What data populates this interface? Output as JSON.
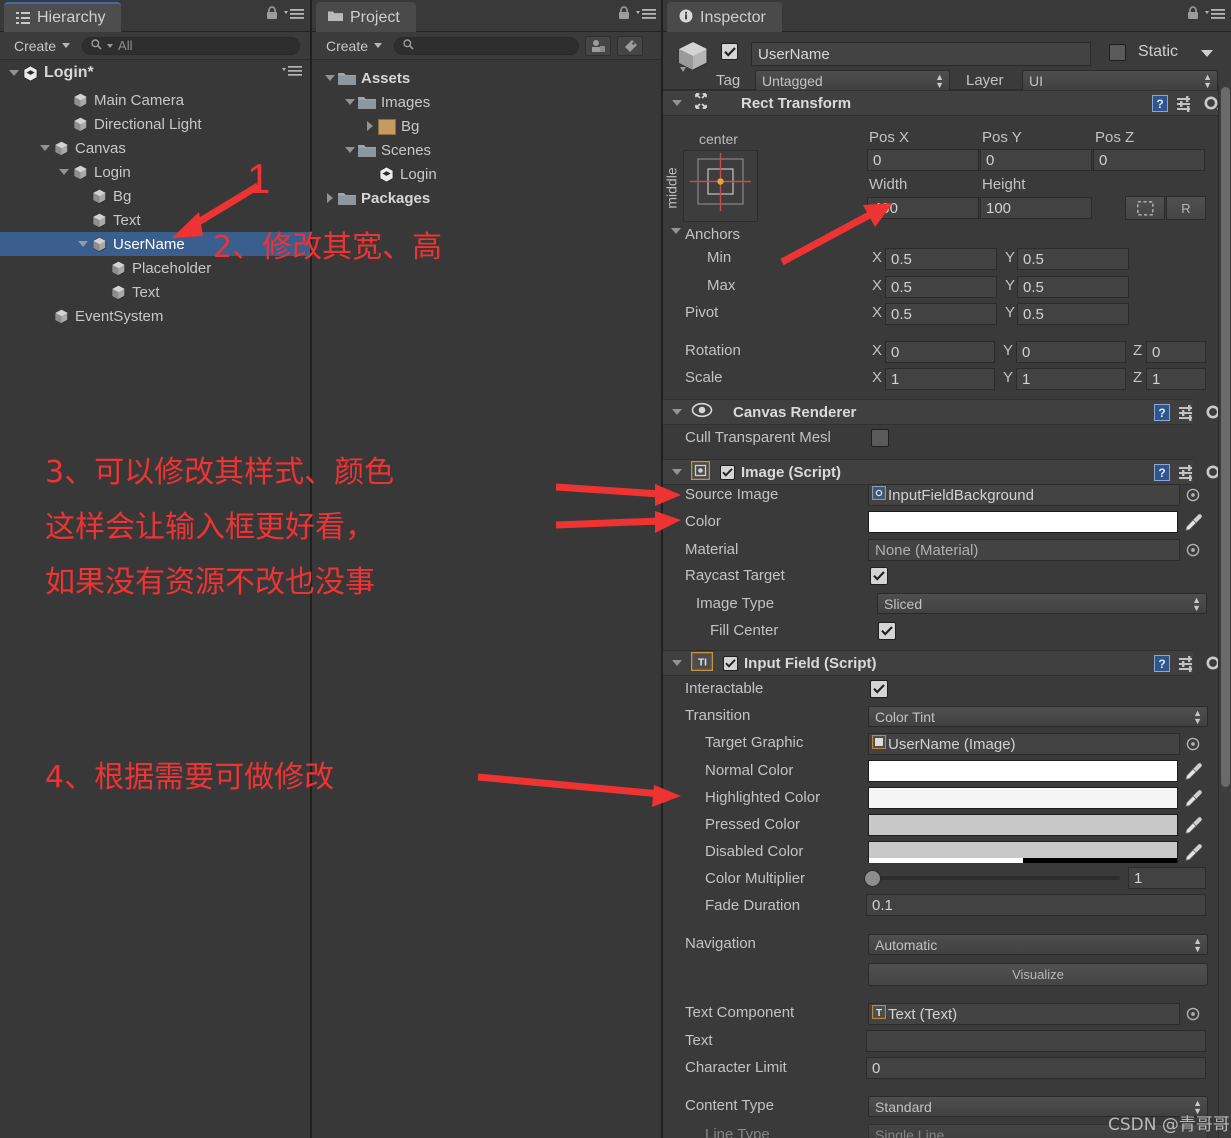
{
  "hierarchy": {
    "tab_label": "Hierarchy",
    "tab_icon": "hierarchy-icon",
    "create_label": "Create",
    "search_placeholder": "All",
    "scene_name": "Login*",
    "items": [
      {
        "label": "Main Camera",
        "depth": 2,
        "icon": "gameobject-cube-icon",
        "expandable": false,
        "selected": false
      },
      {
        "label": "Directional Light",
        "depth": 2,
        "icon": "gameobject-cube-icon",
        "expandable": false,
        "selected": false
      },
      {
        "label": "Canvas",
        "depth": 1,
        "icon": "gameobject-cube-icon",
        "expandable": true,
        "selected": false
      },
      {
        "label": "Login",
        "depth": 2,
        "icon": "gameobject-cube-icon",
        "expandable": true,
        "selected": false
      },
      {
        "label": "Bg",
        "depth": 3,
        "icon": "gameobject-cube-icon",
        "expandable": false,
        "selected": false
      },
      {
        "label": "Text",
        "depth": 3,
        "icon": "gameobject-cube-icon",
        "expandable": false,
        "selected": false
      },
      {
        "label": "UserName",
        "depth": 3,
        "icon": "gameobject-cube-icon",
        "expandable": true,
        "selected": true
      },
      {
        "label": "Placeholder",
        "depth": 4,
        "icon": "gameobject-cube-icon",
        "expandable": false,
        "selected": false
      },
      {
        "label": "Text",
        "depth": 4,
        "icon": "gameobject-cube-icon",
        "expandable": false,
        "selected": false
      },
      {
        "label": "EventSystem",
        "depth": 1,
        "icon": "gameobject-cube-icon",
        "expandable": false,
        "selected": false
      }
    ]
  },
  "project": {
    "tab_label": "Project",
    "create_label": "Create",
    "search_placeholder": "",
    "items": [
      {
        "label": "Assets",
        "depth": 0,
        "icon": "folder-icon",
        "expandable": true,
        "expanded": true,
        "bold": true
      },
      {
        "label": "Images",
        "depth": 1,
        "icon": "folder-icon",
        "expandable": true,
        "expanded": true,
        "bold": false
      },
      {
        "label": "Bg",
        "depth": 2,
        "icon": "texture-icon",
        "expandable": true,
        "expanded": false,
        "bold": false
      },
      {
        "label": "Scenes",
        "depth": 1,
        "icon": "folder-icon",
        "expandable": true,
        "expanded": true,
        "bold": false
      },
      {
        "label": "Login",
        "depth": 2,
        "icon": "unity-scene-icon",
        "expandable": false,
        "expanded": false,
        "bold": false
      },
      {
        "label": "Packages",
        "depth": 0,
        "icon": "folder-icon",
        "expandable": true,
        "expanded": false,
        "bold": true
      }
    ]
  },
  "inspector": {
    "tab_label": "Inspector",
    "object": {
      "enabled": true,
      "name": "UserName",
      "static_label": "Static",
      "static_checked": false,
      "tag_label": "Tag",
      "tag_value": "Untagged",
      "layer_label": "Layer",
      "layer_value": "UI"
    },
    "rect_transform": {
      "title": "Rect Transform",
      "anchor_preset_top": "center",
      "anchor_preset_side": "middle",
      "pos_x_label": "Pos X",
      "pos_y_label": "Pos Y",
      "pos_z_label": "Pos Z",
      "pos_x": "0",
      "pos_y": "0",
      "pos_z": "0",
      "width_label": "Width",
      "height_label": "Height",
      "width": "400",
      "height": "100",
      "blueprint_btn": "blueprint-mode-icon",
      "raw_btn": "R",
      "anchors_label": "Anchors",
      "min_label": "Min",
      "max_label": "Max",
      "pivot_label": "Pivot",
      "anchor_min_x": "0.5",
      "anchor_min_y": "0.5",
      "anchor_max_x": "0.5",
      "anchor_max_y": "0.5",
      "pivot_x": "0.5",
      "pivot_y": "0.5",
      "rotation_label": "Rotation",
      "rotation_x": "0",
      "rotation_y": "0",
      "rotation_z": "0",
      "scale_label": "Scale",
      "scale_x": "1",
      "scale_y": "1",
      "scale_z": "1",
      "axis_x": "X",
      "axis_y": "Y",
      "axis_z": "Z"
    },
    "canvas_renderer": {
      "title": "Canvas Renderer",
      "cull_label": "Cull Transparent Mesl",
      "cull_checked": false
    },
    "image_script": {
      "title": "Image (Script)",
      "enabled": true,
      "source_image_label": "Source Image",
      "source_image_value": "InputFieldBackground",
      "color_label": "Color",
      "color_value": "#FFFFFF",
      "material_label": "Material",
      "material_value": "None (Material)",
      "raycast_label": "Raycast Target",
      "raycast_checked": true,
      "image_type_label": "Image Type",
      "image_type_value": "Sliced",
      "fill_center_label": "Fill Center",
      "fill_center_checked": true
    },
    "input_field_script": {
      "title": "Input Field (Script)",
      "enabled": true,
      "interactable_label": "Interactable",
      "interactable_checked": true,
      "transition_label": "Transition",
      "transition_value": "Color Tint",
      "target_graphic_label": "Target Graphic",
      "target_graphic_value": "UserName (Image)",
      "normal_color_label": "Normal Color",
      "normal_color_value": "#FFFFFF",
      "highlighted_color_label": "Highlighted Color",
      "highlighted_color_value": "#F5F5F5",
      "pressed_color_label": "Pressed Color",
      "pressed_color_value": "#C8C8C8",
      "disabled_color_label": "Disabled Color",
      "disabled_color_value": "#C8C8C8",
      "color_multiplier_label": "Color Multiplier",
      "color_multiplier_value": "1",
      "fade_duration_label": "Fade Duration",
      "fade_duration_value": "0.1",
      "navigation_label": "Navigation",
      "navigation_value": "Automatic",
      "visualize_label": "Visualize",
      "text_component_label": "Text Component",
      "text_component_value": "Text (Text)",
      "text_label": "Text",
      "text_value": "",
      "character_limit_label": "Character Limit",
      "character_limit_value": "0",
      "content_type_label": "Content Type",
      "content_type_value": "Standard",
      "line_type_label": "Line Type",
      "line_type_value": "Single Line"
    }
  },
  "annotations": {
    "accent_color": "#ef3333",
    "n1": "1",
    "n2": "2、修改其宽、高",
    "n3_line1": "3、可以修改其样式、颜色",
    "n3_line2": "这样会让输入框更好看，",
    "n3_line3": "如果没有资源不改也没事",
    "n4": "4、根据需要可做修改"
  },
  "watermark": {
    "text": "CSDN @青哥哥"
  }
}
